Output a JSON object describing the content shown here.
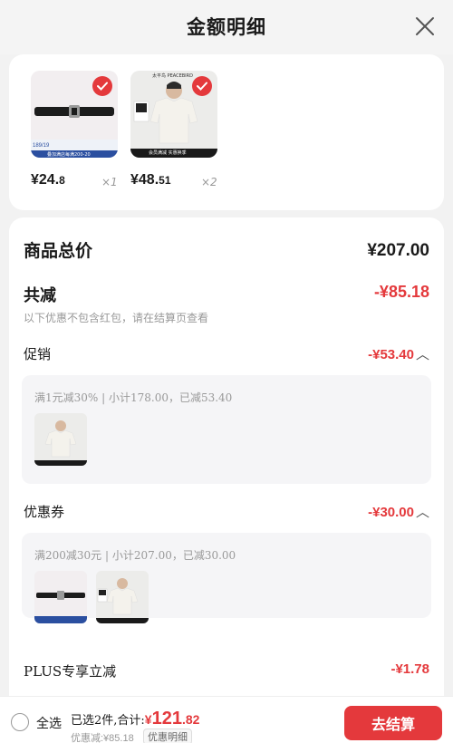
{
  "header": {
    "title": "金额明细"
  },
  "products": [
    {
      "price_whole": "¥24.",
      "price_dec": "8",
      "qty": "×1",
      "checked": true
    },
    {
      "price_whole": "¥48.",
      "price_dec": "51",
      "qty": "×2",
      "checked": true
    }
  ],
  "product_thumb_text": {
    "belt_badge": "189/19",
    "belt_banner": "叠加满店每满200-20",
    "shirt_brand": "太平鸟 PEACEBIRD",
    "shirt_banner": "会员满减 实惠换季"
  },
  "details": {
    "total_label": "商品总价",
    "total_value": "¥207.00",
    "reduce_label": "共减",
    "reduce_value": "-¥85.18",
    "note": "以下优惠不包含红包，请在结算页查看",
    "promo": {
      "label": "促销",
      "value": "-¥53.40",
      "desc": "满1元减30% | 小计178.00，已减53.40"
    },
    "coupon": {
      "label": "优惠券",
      "value": "-¥30.00",
      "desc": "满200减30元 | 小计207.00，已减30.00"
    },
    "plus": {
      "label": "PLUS专享立减",
      "value": "-¥1.78"
    }
  },
  "footer": {
    "select_all": "全选",
    "summary_prefix": "已选2件,合计:",
    "amount_currency": "¥",
    "amount_int": "121",
    "amount_dec": ".82",
    "discount_text": "优惠减:¥85.18",
    "detail_button": "优惠明细",
    "checkout_button": "去结算"
  },
  "colors": {
    "accent": "#e4393c",
    "background": "#f2f2f2"
  }
}
